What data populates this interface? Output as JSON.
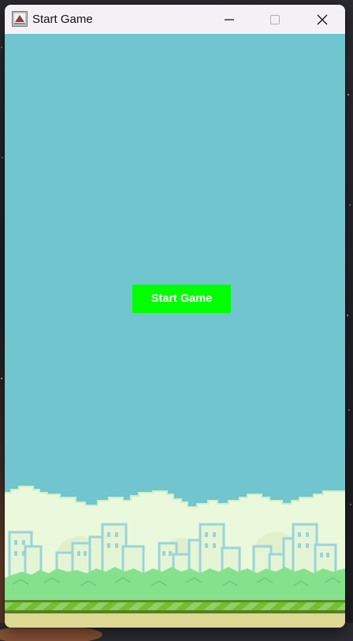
{
  "window": {
    "title": "Start Game"
  },
  "game": {
    "start_button_label": "Start Game"
  },
  "colors": {
    "sky": "#70c5ce",
    "button": "#00ff00",
    "ground": "#ded895",
    "grass": "#8fd163"
  },
  "icons": {
    "app": "java-app-icon",
    "minimize": "minimize-icon",
    "maximize": "maximize-icon",
    "close": "close-icon"
  }
}
